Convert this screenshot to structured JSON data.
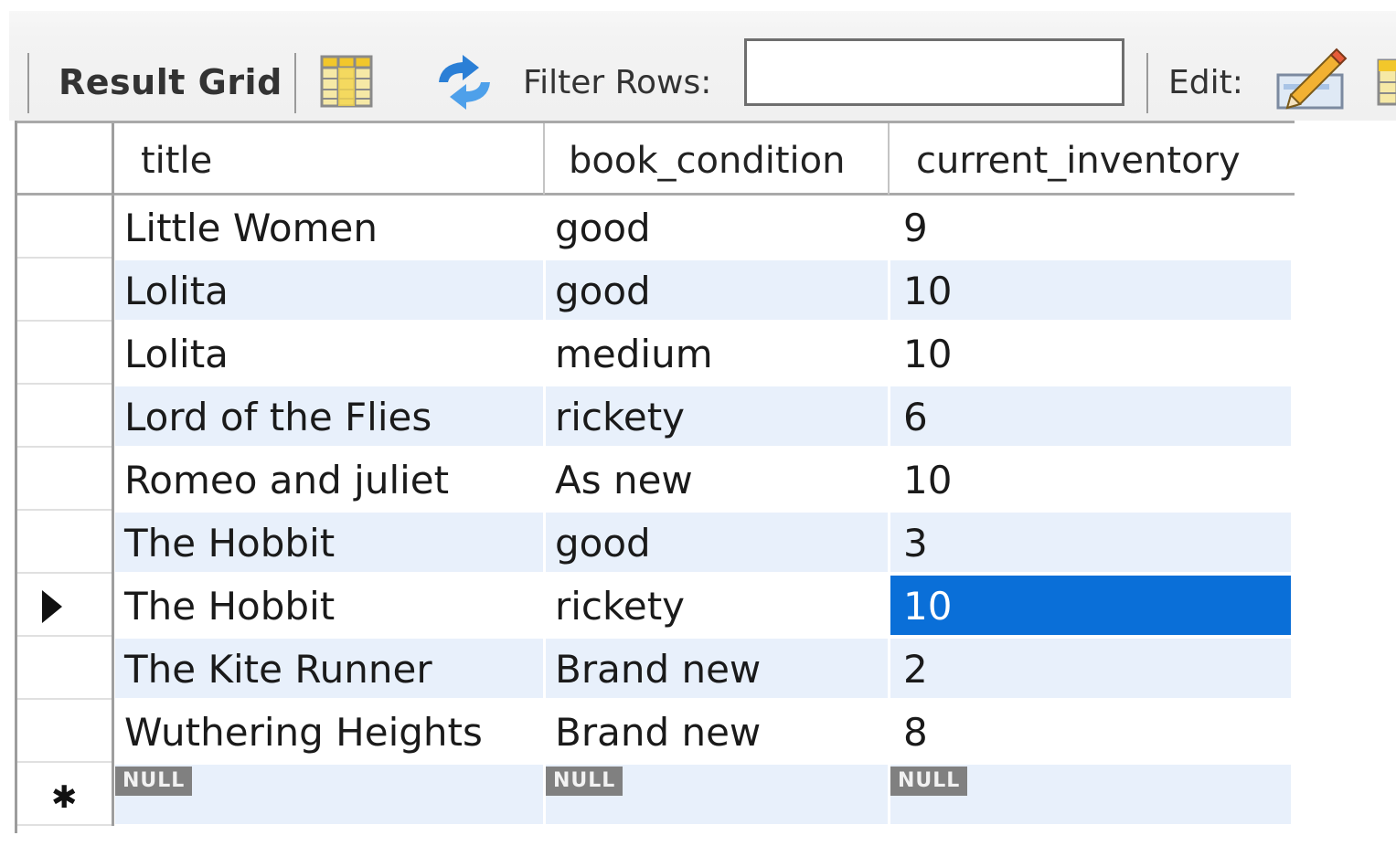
{
  "toolbar": {
    "result_grid_label": "Result Grid",
    "filter_label": "Filter Rows:",
    "filter_value": "",
    "edit_label": "Edit:",
    "icons": [
      "grid-layout-icon",
      "refresh-icon",
      "edit-pencil-icon",
      "export-icon"
    ]
  },
  "grid": {
    "columns": [
      "title",
      "book_condition",
      "current_inventory"
    ],
    "rows": [
      {
        "title": "Little Women",
        "book_condition": "good",
        "current_inventory": "9"
      },
      {
        "title": "Lolita",
        "book_condition": "good",
        "current_inventory": "10"
      },
      {
        "title": "Lolita",
        "book_condition": "medium",
        "current_inventory": "10"
      },
      {
        "title": "Lord of the Flies",
        "book_condition": "rickety",
        "current_inventory": "6"
      },
      {
        "title": "Romeo and juliet",
        "book_condition": "As new",
        "current_inventory": "10"
      },
      {
        "title": "The Hobbit",
        "book_condition": "good",
        "current_inventory": "3"
      },
      {
        "title": "The Hobbit",
        "book_condition": "rickety",
        "current_inventory": "10"
      },
      {
        "title": "The Kite Runner",
        "book_condition": "Brand new",
        "current_inventory": "2"
      },
      {
        "title": "Wuthering Heights",
        "book_condition": "Brand new",
        "current_inventory": "8"
      }
    ],
    "current_row_index": 6,
    "selected_cell": {
      "row": 6,
      "column": "current_inventory"
    },
    "new_row": {
      "title": "NULL",
      "book_condition": "NULL",
      "current_inventory": "NULL"
    },
    "colors": {
      "selection": "#0a6fd8",
      "alt_row": "#e8f0fb",
      "null_badge": "#808080"
    }
  }
}
